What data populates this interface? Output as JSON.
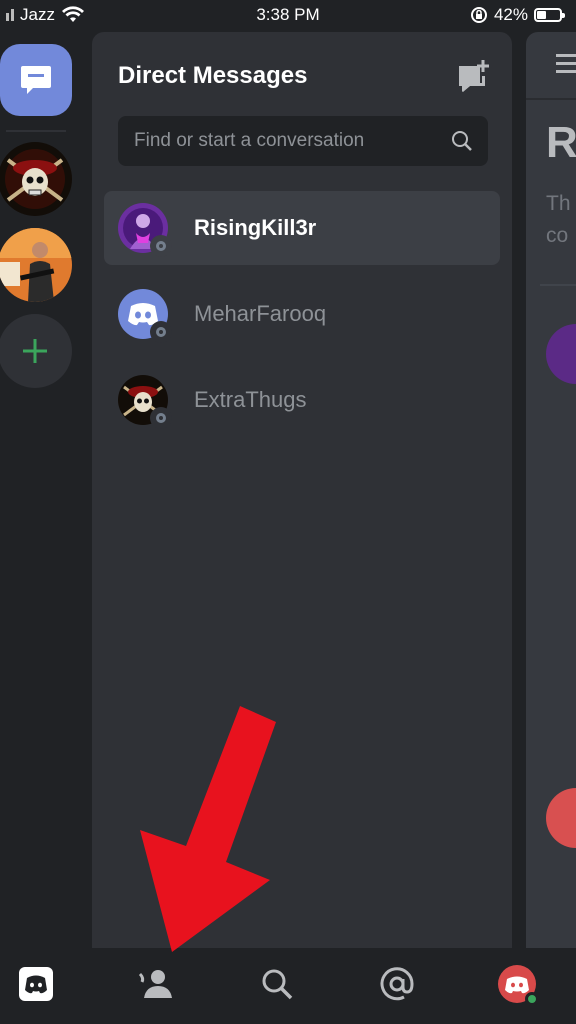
{
  "status_bar": {
    "carrier": "Jazz",
    "time": "3:38 PM",
    "battery": "42%",
    "battery_level": 0.42
  },
  "dm_panel": {
    "title": "Direct Messages",
    "search_placeholder": "Find or start a conversation",
    "conversations": [
      {
        "name": "RisingKill3r",
        "selected": true,
        "status": "offline",
        "avatar": "purple-avatar"
      },
      {
        "name": "MeharFarooq",
        "selected": false,
        "status": "offline",
        "avatar": "discord-default-avatar"
      },
      {
        "name": "ExtraThugs",
        "selected": false,
        "status": "offline",
        "avatar": "pirate-skull-avatar"
      }
    ]
  },
  "peek": {
    "title_fragment": "R",
    "subtitle_line1": "Th",
    "subtitle_line2": "co"
  },
  "tabs": [
    "home-icon",
    "friends-icon",
    "search-icon",
    "mentions-icon",
    "profile-avatar"
  ],
  "colors": {
    "blurple": "#7289da",
    "green": "#3ba55c",
    "annotation_red": "#e8121e",
    "panel": "#2f3136",
    "rail": "#202225"
  }
}
